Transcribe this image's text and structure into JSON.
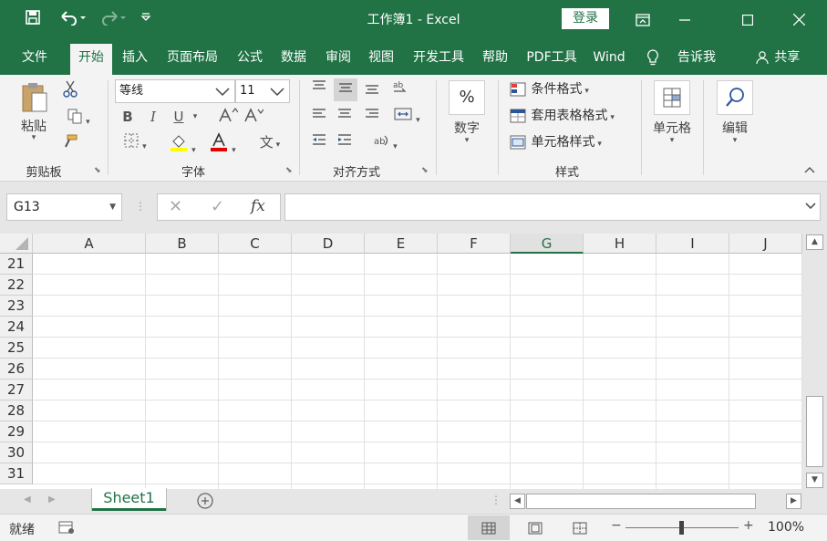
{
  "titlebar": {
    "title": "工作簿1  -  Excel",
    "login": "登录",
    "icons": [
      "save-icon",
      "undo-icon",
      "redo-icon",
      "customize-qat-icon"
    ],
    "accent": "#217346"
  },
  "tabs": [
    {
      "label": "文件"
    },
    {
      "label": "开始",
      "active": true
    },
    {
      "label": "插入"
    },
    {
      "label": "页面布局"
    },
    {
      "label": "公式"
    },
    {
      "label": "数据"
    },
    {
      "label": "审阅"
    },
    {
      "label": "视图"
    },
    {
      "label": "开发工具"
    },
    {
      "label": "帮助"
    },
    {
      "label": "PDF工具"
    },
    {
      "label": "Wind"
    },
    {
      "label": "告诉我"
    },
    {
      "label": "共享"
    }
  ],
  "ribbon": {
    "clipboard": {
      "label": "剪贴板",
      "paste": "粘贴"
    },
    "font": {
      "label": "字体",
      "font_name": "等线",
      "font_size": "11",
      "bold": "B",
      "italic": "I",
      "underline": "U",
      "phonetic": "文"
    },
    "alignment": {
      "label": "对齐方式"
    },
    "number": {
      "label": "数字",
      "symbol": "%"
    },
    "styles": {
      "label": "样式",
      "conditional": "条件格式",
      "table": "套用表格格式",
      "cell_styles": "单元格样式"
    },
    "cells": {
      "label": "单元格"
    },
    "editing": {
      "label": "编辑"
    }
  },
  "formula_bar": {
    "name_box": "G13",
    "cancel": "✕",
    "enter": "✓",
    "fx": "fx",
    "value": ""
  },
  "grid": {
    "columns": [
      "A",
      "B",
      "C",
      "D",
      "E",
      "F",
      "G",
      "H",
      "I",
      "J"
    ],
    "selected_column": "G",
    "rows": [
      "21",
      "22",
      "23",
      "24",
      "25",
      "26",
      "27",
      "28",
      "29",
      "30",
      "31"
    ]
  },
  "sheets": [
    {
      "label": "Sheet1",
      "active": true
    }
  ],
  "statusbar": {
    "status": "就绪",
    "zoom": "100%",
    "zoom_minus": "−",
    "zoom_plus": "+"
  }
}
